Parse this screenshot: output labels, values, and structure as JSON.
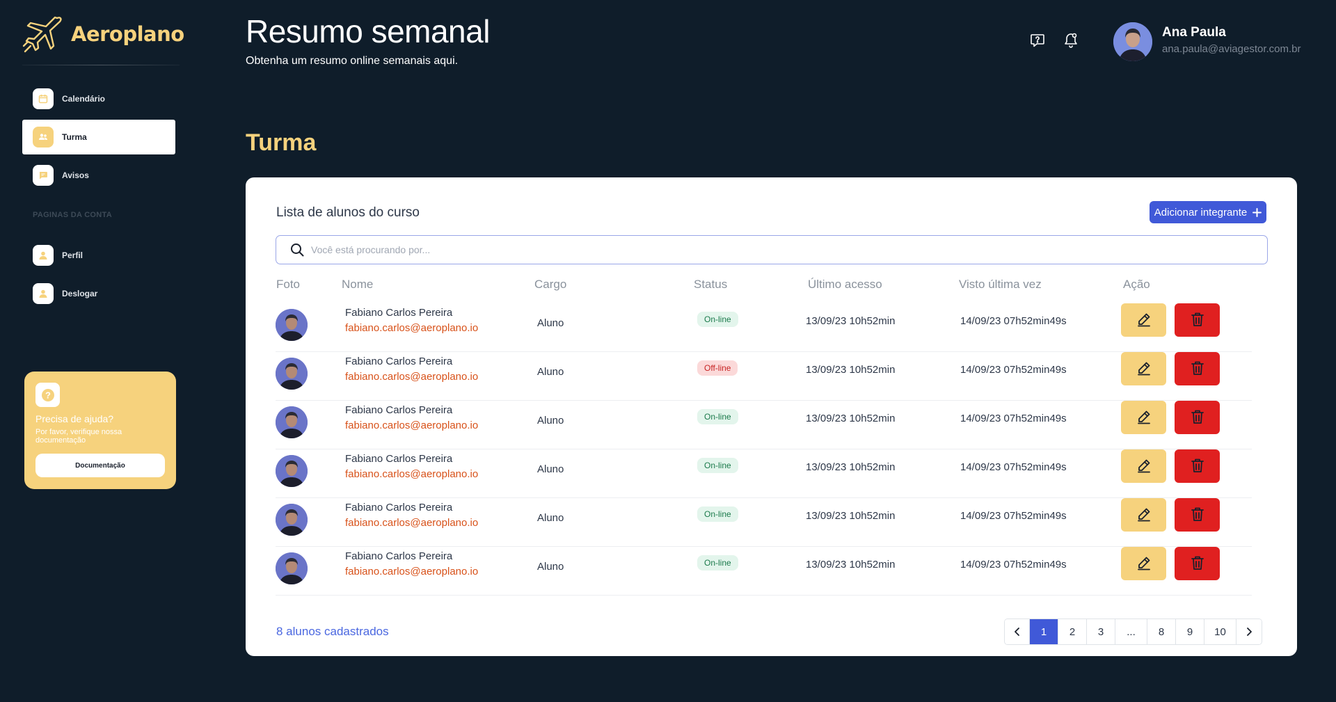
{
  "app": {
    "name": "Aeroplano",
    "brand_color": "#f6d27d",
    "accent_color": "#4059d8"
  },
  "sidebar": {
    "items": [
      {
        "label": "Calendário",
        "icon": "calendar-icon"
      },
      {
        "label": "Turma",
        "icon": "users-icon",
        "active": true
      },
      {
        "label": "Avisos",
        "icon": "message-icon"
      }
    ],
    "section_label": "PAGINAS DA CONTA",
    "account_items": [
      {
        "label": "Perfil",
        "icon": "user-icon"
      },
      {
        "label": "Deslogar",
        "icon": "user-icon"
      }
    ],
    "help": {
      "title": "Precisa de ajuda?",
      "subtitle": "Por favor, verifique nossa documentação",
      "button": "Documentação"
    }
  },
  "header": {
    "title": "Resumo semanal",
    "subtitle": "Obtenha um resumo online semanais aqui.",
    "user": {
      "name": "Ana Paula",
      "email": "ana.paula@aviagestor.com.br"
    }
  },
  "section": {
    "title": "Turma"
  },
  "table": {
    "title": "Lista de alunos do curso",
    "add_button": "Adicionar integrante",
    "search_placeholder": "Você está procurando por...",
    "columns": [
      "Foto",
      "Nome",
      "Cargo",
      "Status",
      "Último acesso",
      "Visto última vez",
      "Ação"
    ],
    "rows": [
      {
        "name": "Fabiano Carlos Pereira",
        "email": "fabiano.carlos@aeroplano.io",
        "role": "Aluno",
        "status": "On-line",
        "last_access": "13/09/23 10h52min",
        "last_seen": "14/09/23 07h52min49s"
      },
      {
        "name": "Fabiano Carlos Pereira",
        "email": "fabiano.carlos@aeroplano.io",
        "role": "Aluno",
        "status": "Off-line",
        "last_access": "13/09/23 10h52min",
        "last_seen": "14/09/23 07h52min49s"
      },
      {
        "name": "Fabiano Carlos Pereira",
        "email": "fabiano.carlos@aeroplano.io",
        "role": "Aluno",
        "status": "On-line",
        "last_access": "13/09/23 10h52min",
        "last_seen": "14/09/23 07h52min49s"
      },
      {
        "name": "Fabiano Carlos Pereira",
        "email": "fabiano.carlos@aeroplano.io",
        "role": "Aluno",
        "status": "On-line",
        "last_access": "13/09/23 10h52min",
        "last_seen": "14/09/23 07h52min49s"
      },
      {
        "name": "Fabiano Carlos Pereira",
        "email": "fabiano.carlos@aeroplano.io",
        "role": "Aluno",
        "status": "On-line",
        "last_access": "13/09/23 10h52min",
        "last_seen": "14/09/23 07h52min49s"
      },
      {
        "name": "Fabiano Carlos Pereira",
        "email": "fabiano.carlos@aeroplano.io",
        "role": "Aluno",
        "status": "On-line",
        "last_access": "13/09/23 10h52min",
        "last_seen": "14/09/23 07h52min49s"
      }
    ],
    "footer_count": "8 alunos cadastrados",
    "pagination": {
      "pages": [
        "1",
        "2",
        "3",
        "...",
        "8",
        "9",
        "10"
      ],
      "current": "1"
    }
  }
}
